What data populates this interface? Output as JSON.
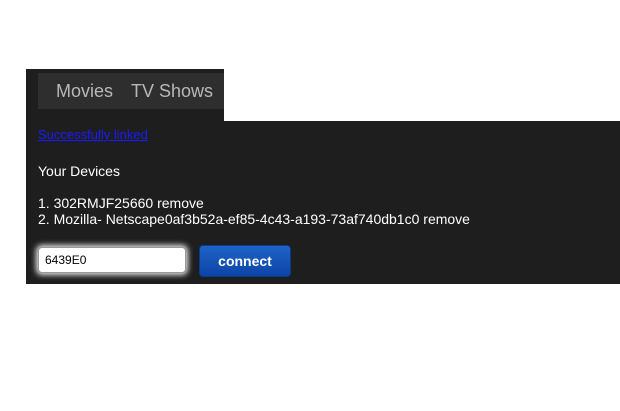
{
  "nav": {
    "items": [
      {
        "label": "Movies"
      },
      {
        "label": "TV Shows"
      }
    ]
  },
  "status": {
    "link_text": "Successfully linked"
  },
  "devices": {
    "heading": "Your Devices",
    "items": [
      {
        "index": "1.",
        "name": "302RMJF25660",
        "action": "remove"
      },
      {
        "index": "2.",
        "name": "Mozilla- Netscape0af3b52a-ef85-4c43-a193-73af740db1c0",
        "action": "remove"
      }
    ]
  },
  "connect_form": {
    "code_value": "6439E0",
    "button_label": "connect"
  },
  "colors": {
    "panel_bg": "#1e1e1e",
    "nav_bg": "#2e2e2e",
    "link": "#1a1aff",
    "button": "#1f63c8"
  }
}
